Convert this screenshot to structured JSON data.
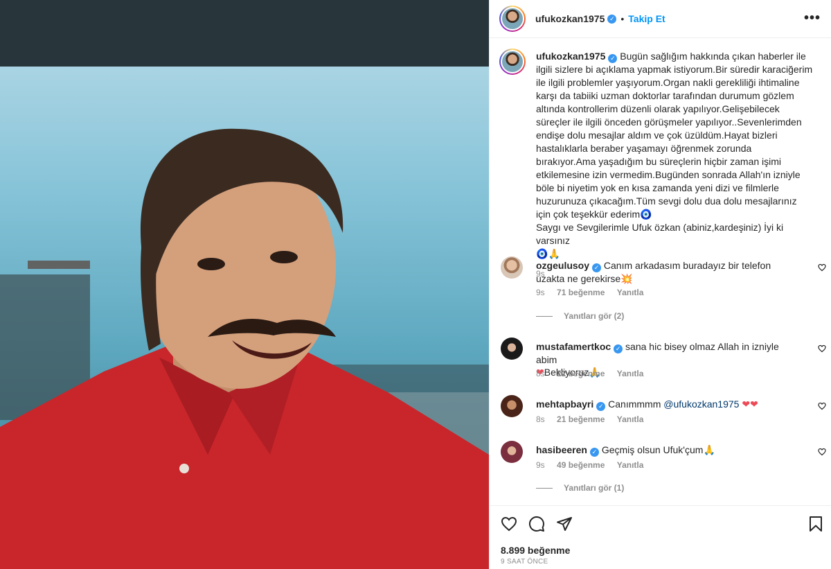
{
  "post": {
    "author": "ufukozkan1975",
    "follow_label": "Takip Et",
    "dot": "•",
    "more_label": "•••",
    "caption": "Bugün sağlığım hakkında çıkan haberler ile ilgili sizlere bi açıklama yapmak istiyorum.Bir süredir karaciğerim ile ilgili problemler yaşıyorum.Organ nakli gerekliliği ihtimaline karşı da tabiiki uzman doktorlar tarafından durumum gözlem altında kontrollerim düzenli olarak yapılıyor.Gelişebilecek süreçler ile ilgili önceden görüşmeler yapılıyor..Sevenlerimden endişe dolu mesajlar aldım ve çok üzüldüm.Hayat bizleri hastalıklarla beraber yaşamayı öğrenmek zorunda bırakıyor.Ama yaşadığım bu süreçlerin hiçbir zaman işimi etkilemesine izin vermedim.Bugünden sonrada Allah'ın izniyle böle bi niyetim yok en kısa zamanda yeni dizi ve filmlerle huzurunuza çıkacağım.Tüm sevgi dolu dua dolu mesajlarınız için çok teşekkür ederim",
    "caption_tail": "Saygı ve Sevgilerimle Ufuk özkan (abiniz,kardeşiniz) İyi ki varsınız",
    "caption_time": "9s",
    "likes": "8.899 beğenme",
    "posted_ago": "9 SAAT ÖNCE"
  },
  "comments": [
    {
      "user": "ozgeulusoy",
      "text": "Canım arkadasım buradayız bir telefon uzakta ne gerekirse",
      "time": "9s",
      "likes": "71 beğenme",
      "reply": "Yanıtla",
      "view_replies": "Yanıtları gör (2)",
      "avatar_color": "#c9a48a"
    },
    {
      "user": "mustafamertkoc",
      "text": "sana hic bisey olmaz Allah in izniyle abim",
      "text2": "Bekliyoruz",
      "time": "8s",
      "likes": "22 beğenme",
      "reply": "Yanıtla",
      "avatar_color": "#2b2b2b"
    },
    {
      "user": "mehtapbayri",
      "text": "Canımmmm",
      "mention": "@ufukozkan1975",
      "time": "8s",
      "likes": "21 beğenme",
      "reply": "Yanıtla",
      "avatar_color": "#6b3a2a"
    },
    {
      "user": "hasibeeren",
      "text": "Geçmiş olsun Ufuk'çum",
      "time": "9s",
      "likes": "49 beğenme",
      "reply": "Yanıtla",
      "view_replies": "Yanıtları gör (1)",
      "avatar_color": "#8a3a4a"
    }
  ],
  "colors": {
    "accent": "#0095f6",
    "verified": "#3897f0",
    "heart": "#ed4956",
    "shirt": "#c8262b"
  }
}
